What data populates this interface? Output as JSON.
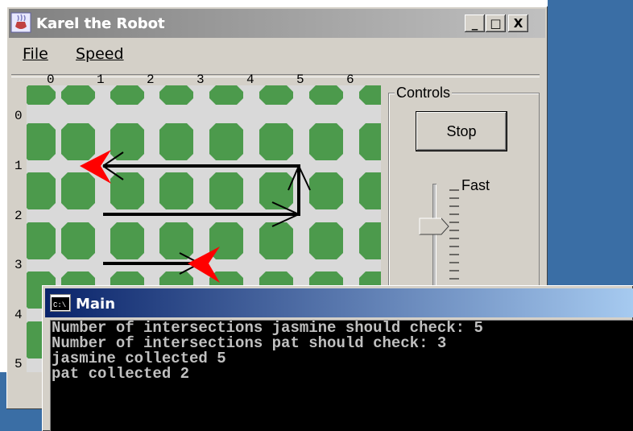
{
  "karel_window": {
    "title": "Karel the Robot",
    "buttons": {
      "minimize": "_",
      "maximize": "□",
      "close": "X"
    },
    "menu": {
      "file": "File",
      "speed": "Speed"
    }
  },
  "world": {
    "col_labels": [
      "0",
      "1",
      "2",
      "3",
      "4",
      "5",
      "6"
    ],
    "row_labels": [
      "0",
      "1",
      "2",
      "3",
      "4",
      "5"
    ],
    "colors": {
      "block": "#4c9a4c",
      "street": "#d9d9d9",
      "robot": "#ff0000"
    }
  },
  "controls": {
    "group_label": "Controls",
    "stop_label": "Stop",
    "speed_label": "Fast"
  },
  "console": {
    "title": "Main",
    "lines": [
      "Number of intersections jasmine should check: 5",
      "Number of intersections pat should check: 3",
      "jasmine collected 5",
      "pat collected 2"
    ]
  }
}
